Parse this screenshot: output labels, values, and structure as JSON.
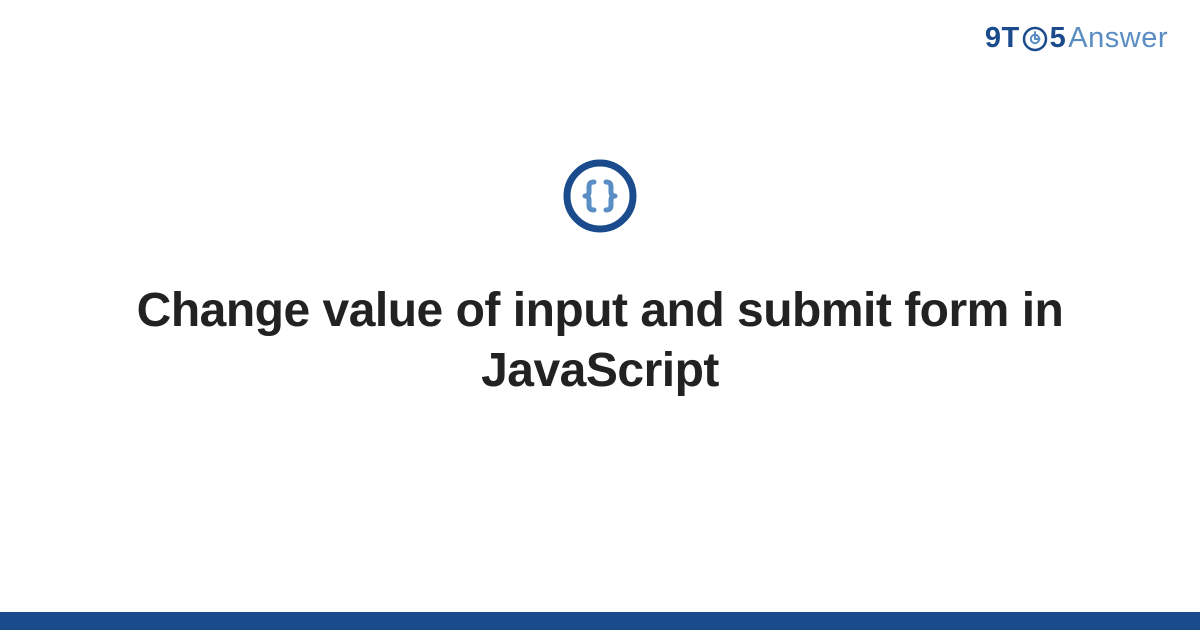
{
  "logo": {
    "part1": "9T",
    "part2": "5",
    "part3": "Answer",
    "icon_name": "clock-icon"
  },
  "category": {
    "icon_name": "braces-icon"
  },
  "title": "Change value of input and submit form in JavaScript",
  "colors": {
    "brand_primary": "#1a4b8c",
    "brand_secondary": "#5a8dc4",
    "icon_ring": "#1a4b8c",
    "icon_inner": "#5a8dc4",
    "footer": "#1a4b8c",
    "text": "#222222"
  }
}
